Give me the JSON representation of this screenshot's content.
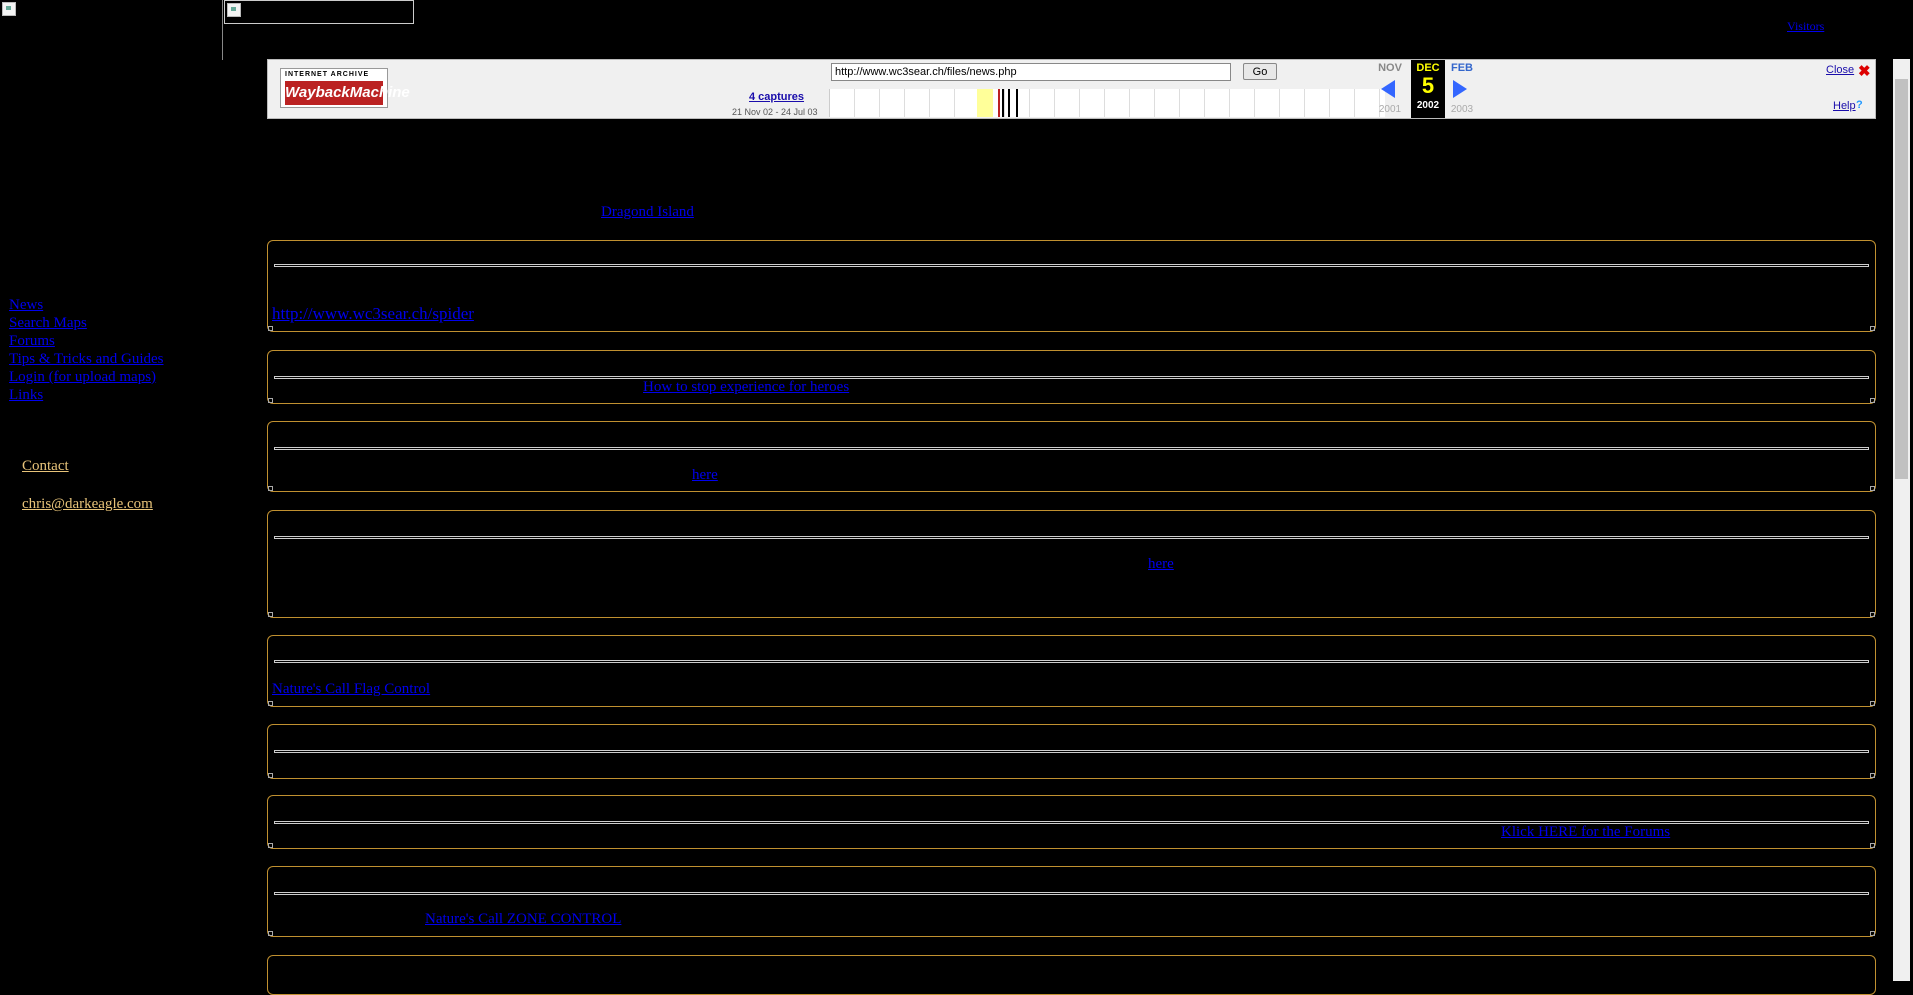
{
  "header": {
    "visitors_label": "Visitors"
  },
  "wayback": {
    "logo_top": "INTERNET ARCHIVE",
    "logo_main": "WaybackMachine",
    "url": "http://www.wc3sear.ch/files/news.php",
    "go_label": "Go",
    "captures": "4 captures",
    "range": "21 Nov 02 - 24 Jul 03",
    "prev_month": "NOV",
    "cur_month": "DEC",
    "cur_day": "5",
    "cur_year": "2002",
    "next_month": "FEB",
    "prev_year": "2001",
    "next_year": "2003",
    "close_label": "Close",
    "close_icon": "✖",
    "help_label": "Help",
    "help_icon": "?",
    "colors": {
      "bar": "#f0f0f0",
      "highlight": "#ffff99",
      "accent": "#3366ff"
    }
  },
  "nav": {
    "items": [
      "News",
      "Search Maps",
      "Forums",
      "Tips & Tricks and Guides",
      "Login (for upload maps)",
      "Links"
    ],
    "contact": "Contact",
    "email": "chris@darkeagle.com"
  },
  "content": {
    "top_link": "Dragond Island",
    "links": [
      "http://www.wc3sear.ch/spider",
      "How to stop experience for heroes",
      "here",
      "here",
      "Nature's Call Flag Control",
      "Klick HERE for the Forums",
      "Nature's Call ZONE CONTROL"
    ]
  },
  "colors": {
    "background": "#000000",
    "box_border": "#c09030",
    "link": "#0000ee",
    "contact": "#e8c47a"
  }
}
